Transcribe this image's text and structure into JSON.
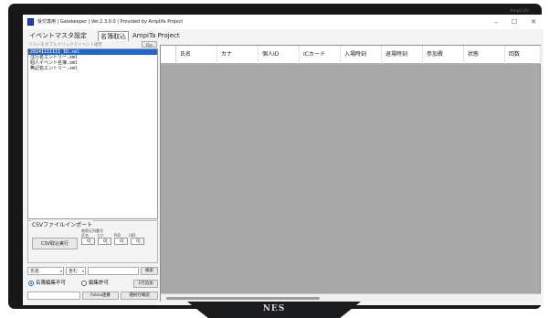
{
  "window": {
    "title": "受付専用 | Gatekeeper | Ver.2.3.0.0 | Provided by Amplife Project",
    "brand_corner": "AmpLife",
    "controls": {
      "minimize": "–",
      "maximize": "☐",
      "close": "✕"
    }
  },
  "monitor": {
    "stand_label": "NES"
  },
  "tabs": [
    {
      "label": "イベントマスタ設定",
      "active": false
    },
    {
      "label": "名簿取込",
      "active": true
    },
    {
      "label": "AmpiTa Project",
      "active": false
    }
  ],
  "file_panel": {
    "hint": "リストをダブルクリックでイベント確定",
    "file_button": "File",
    "files": [
      {
        "name": "2024IIIIIII_ID.xml",
        "selected": true
      },
      {
        "name": "注行名エントリー.xml",
        "selected": false
      },
      {
        "name": "個人イベント名簿.xml",
        "selected": false
      },
      {
        "name": "無記名エントリー.xml",
        "selected": false
      }
    ]
  },
  "csv_import": {
    "title": "CSVファイルインポート",
    "run_button": "CSV取込実行",
    "column_caption": "参照元列番号",
    "columns": [
      {
        "label": "氏名",
        "value": "0"
      },
      {
        "label": "カナ",
        "value": "0"
      },
      {
        "label": "PID",
        "value": "0"
      },
      {
        "label": "UID",
        "value": "0"
      }
    ]
  },
  "filter": {
    "field_select": "氏名",
    "mode_select": "含む",
    "search_value": "",
    "search_button": "検索"
  },
  "edit_mode": {
    "option_locked": "名簿編集不可",
    "option_unlocked": "編集許可",
    "selected": "locked",
    "insert_button": "1行追加"
  },
  "bottom": {
    "field_value": "",
    "felica_button": "Felica連番",
    "confirm_button": "選択行確認"
  },
  "grid": {
    "columns": [
      "氏名",
      "カナ",
      "個人ID",
      "ICカード",
      "入場時刻",
      "退場時刻",
      "参加費",
      "状態",
      "回数"
    ]
  }
}
